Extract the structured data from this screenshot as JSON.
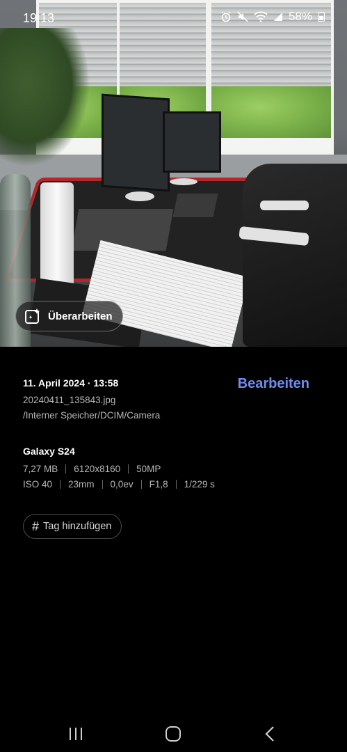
{
  "status_bar": {
    "time": "19:13",
    "battery": "58%",
    "icons": [
      "alarm-icon",
      "mute-icon",
      "wifi-icon",
      "signal-icon",
      "battery-icon"
    ]
  },
  "photo": {
    "edit_chip_label": "Überarbeiten"
  },
  "details": {
    "date_time": "11. April 2024 · 13:58",
    "edit_label": "Bearbeiten",
    "filename": "20240411_135843.jpg",
    "path": "/Interner Speicher/DCIM/Camera",
    "device": "Galaxy S24",
    "size_row": [
      "7,27 MB",
      "6120x8160",
      "50MP"
    ],
    "exposure_row": [
      "ISO 40",
      "23mm",
      "0,0ev",
      "F1,8",
      "1/229 s"
    ],
    "add_tag_label": "Tag hinzufügen"
  },
  "colors": {
    "accent": "#6f8ff0",
    "background": "#000000",
    "secondary_text": "#b7b7b7"
  }
}
